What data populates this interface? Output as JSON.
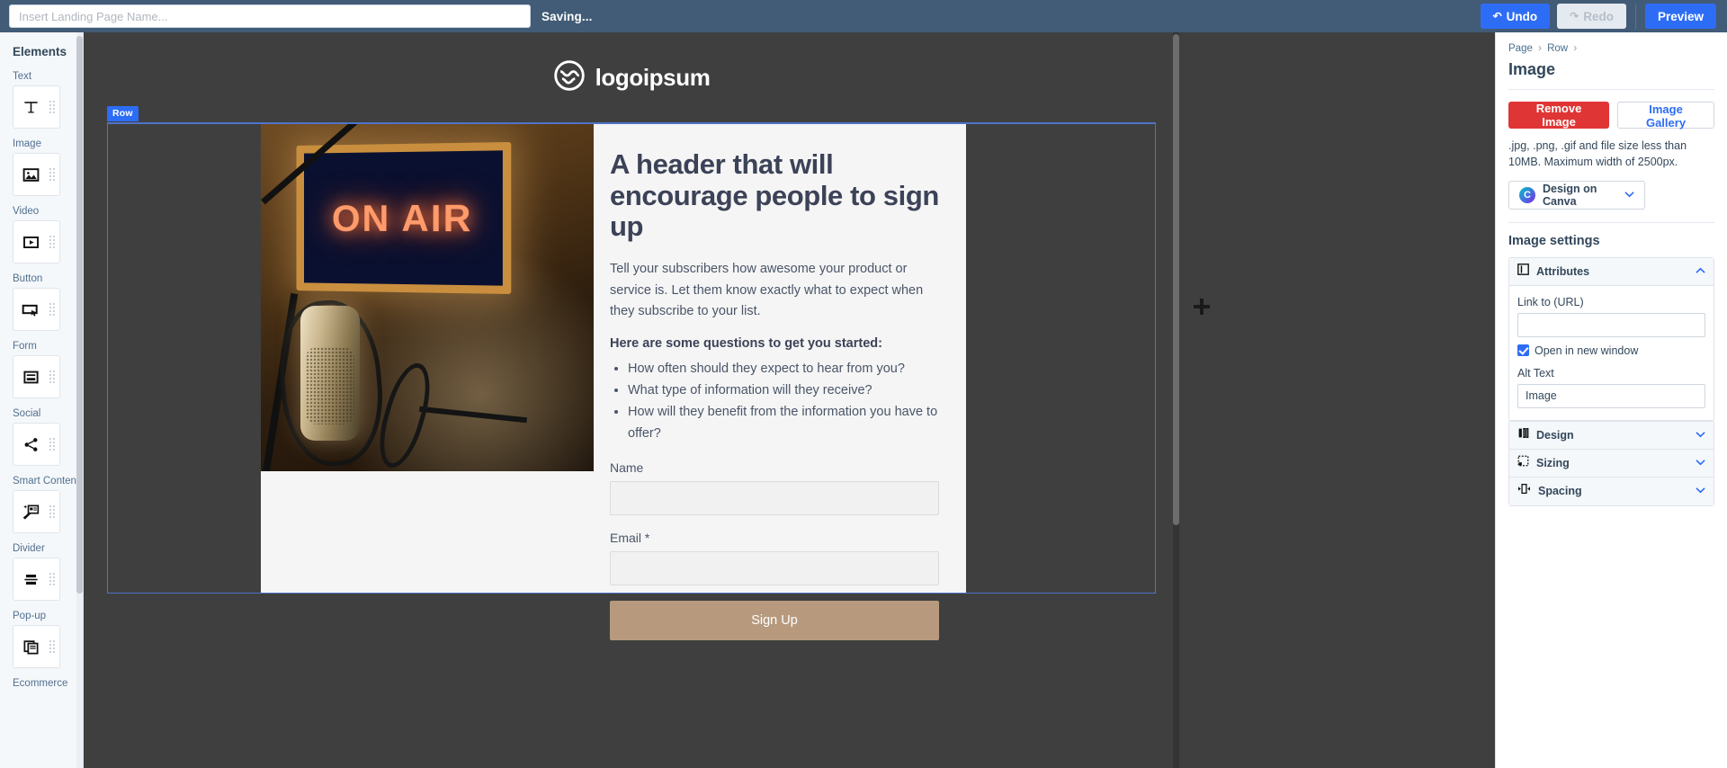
{
  "topbar": {
    "page_name_value": "",
    "page_name_placeholder": "Insert Landing Page Name...",
    "saving_status": "Saving...",
    "undo_label": "Undo",
    "undo_icon": "undo-arrow-icon",
    "redo_label": "Redo",
    "redo_icon": "redo-arrow-icon",
    "preview_label": "Preview"
  },
  "sidebar": {
    "title": "Elements",
    "items": [
      {
        "label": "Text",
        "icon": "text-t-icon",
        "glyph": "T"
      },
      {
        "label": "Image",
        "icon": "image-picture-icon",
        "glyph": "⛰"
      },
      {
        "label": "Video",
        "icon": "video-play-icon",
        "glyph": "▶"
      },
      {
        "label": "Button",
        "icon": "button-cursor-icon",
        "glyph": "▭"
      },
      {
        "label": "Form",
        "icon": "form-lines-icon",
        "glyph": "≡"
      },
      {
        "label": "Social",
        "icon": "social-share-icon",
        "glyph": "⑂"
      },
      {
        "label": "Smart Content",
        "icon": "smart-content-magic-icon",
        "glyph": "✨"
      },
      {
        "label": "Divider",
        "icon": "divider-icon",
        "glyph": "☰"
      },
      {
        "label": "Pop-up",
        "icon": "popup-windows-icon",
        "glyph": "⧉"
      },
      {
        "label": "Ecommerce",
        "icon": "ecommerce-cart-icon",
        "glyph": "⛁"
      }
    ]
  },
  "canvas": {
    "row_badge": "Row",
    "logo_text": "logoipsum",
    "logo_icon": "logoipsum-circle-icon",
    "hero": {
      "image_alt": "on-air-studio-microphone-photo",
      "image_sign_text": "ON AIR",
      "heading": "A header that will encourage people to sign up",
      "paragraph": "Tell your subscribers how awesome your product or service is. Let them know exactly what to expect when they subscribe to your list.",
      "questions_intro": "Here are some questions to get you started:",
      "questions": [
        "How often should they expect to hear from you?",
        "What type of information will they receive?",
        "How will they benefit from the information you have to offer?"
      ],
      "form": {
        "name_label": "Name",
        "name_value": "",
        "email_label": "Email *",
        "email_value": "",
        "submit_label": "Sign Up"
      }
    }
  },
  "right_panel": {
    "breadcrumb": {
      "page": "Page",
      "row": "Row",
      "separator": "›"
    },
    "title": "Image",
    "remove_image_label": "Remove Image",
    "image_gallery_label": "Image Gallery",
    "note": ".jpg, .png, .gif and file size less than 10MB. Maximum width of 2500px.",
    "canva": {
      "label": "Design on Canva",
      "badge": "C",
      "chevron": "⌄"
    },
    "settings_title": "Image settings",
    "attributes": {
      "title": "Attributes",
      "icon": "attributes-panel-icon",
      "expanded": true,
      "chevron": "⌃",
      "link_label": "Link to (URL)",
      "link_value": "",
      "open_new_window_label": "Open in new window",
      "open_new_window_checked": true,
      "alt_text_label": "Alt Text",
      "alt_text_value": "Image"
    },
    "sections": [
      {
        "title": "Design",
        "icon": "design-brush-icon",
        "chevron": "⌄",
        "glyph": "✑"
      },
      {
        "title": "Sizing",
        "icon": "sizing-crop-icon",
        "chevron": "⌄",
        "glyph": "⬚"
      },
      {
        "title": "Spacing",
        "icon": "spacing-arrows-icon",
        "chevron": "⌄",
        "glyph": "⬌"
      }
    ]
  },
  "colors": {
    "topbar_bg": "#425b76",
    "accent_blue": "#2d6df6",
    "danger_red": "#e03535",
    "canvas_bg": "#3f3f3f",
    "signup_button": "#b79a7d",
    "row_outline": "#4f74c8"
  }
}
